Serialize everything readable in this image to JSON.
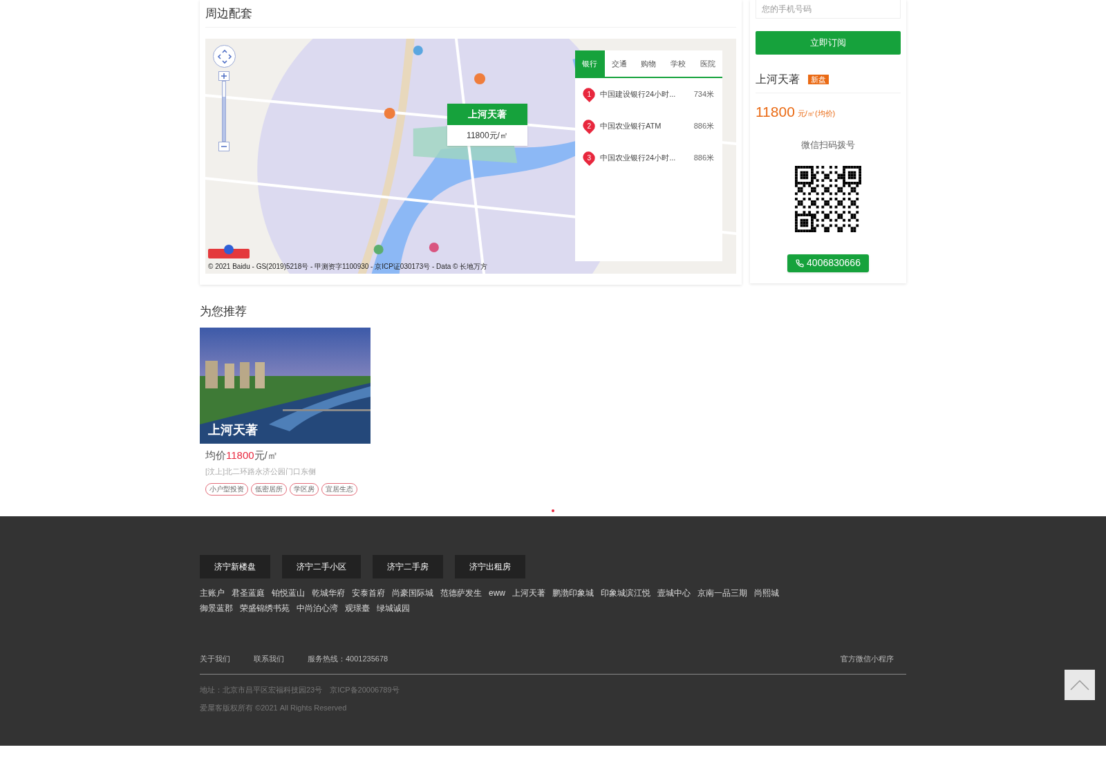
{
  "surroundings": {
    "title": "周边配套",
    "zoom": {
      "level": 0.75
    },
    "marker": {
      "name": "上河天著",
      "price": "11800元/㎡"
    },
    "tabs": [
      {
        "label": "银行",
        "selected": true
      },
      {
        "label": "交通",
        "selected": false
      },
      {
        "label": "购物",
        "selected": false
      },
      {
        "label": "学校",
        "selected": false
      },
      {
        "label": "医院",
        "selected": false
      }
    ],
    "places": [
      {
        "number": "1",
        "name": "中国建设银行24小时...",
        "distance": "734米"
      },
      {
        "number": "2",
        "name": "中国农业银行ATM",
        "distance": "886米"
      },
      {
        "number": "3",
        "name": "中国农业银行24小时...",
        "distance": "886米"
      }
    ],
    "copyright": "© 2021 Baidu - GS(2019)5218号 - 甲测资字1100930 - 京ICP证030173号 - Data © 长地万方"
  },
  "sidebar": {
    "phone_field": {
      "placeholder": "您的手机号码"
    },
    "subscribe_button": "立即订阅",
    "name": "上河天著",
    "badge": "新盘",
    "price": "11800",
    "price_unit": "元/㎡(均价)",
    "qr_caption": "微信扫码拨号",
    "phone": "4006830666"
  },
  "recommend": {
    "title": "为您推荐",
    "cards": [
      {
        "name": "上河天著",
        "price_prefix": "均价",
        "price_value": "11800",
        "price_unit": "元/㎡",
        "address": "[汶上]北二环路永济公园门口东侧",
        "tags": [
          "小户型投资",
          "低密居所",
          "学区房",
          "宜居生态"
        ]
      }
    ],
    "pager": [
      {
        "selected": true
      }
    ]
  },
  "footer": {
    "tabs": [
      {
        "label": "济宁新楼盘"
      },
      {
        "label": "济宁二手小区"
      },
      {
        "label": "济宁二手房"
      },
      {
        "label": "济宁出租房"
      }
    ],
    "links": [
      "主账户",
      "君圣蓝庭",
      "铂悦蓝山",
      "乾城华府",
      "安泰首府",
      "尚豪国际城",
      "范德萨发生",
      "eww",
      "上河天著",
      "鹏渤印象城",
      "印象城滨江悦",
      "壹城中心",
      "京南一品三期",
      "尚熙城",
      "御景蓝郡",
      "荣盛锦绣书苑",
      "中尚泊心湾",
      "观璟臺",
      "绿城诚园"
    ],
    "bottom_links": [
      "关于我们",
      "联系我们",
      "服务热线：4001235678"
    ],
    "mini_program": "官方微信小程序",
    "address": "地址：北京市昌平区宏福科技园23号　京ICP备20006789号",
    "rights": "爱屋客版权所有 ©2021 All Rights Reserved"
  }
}
